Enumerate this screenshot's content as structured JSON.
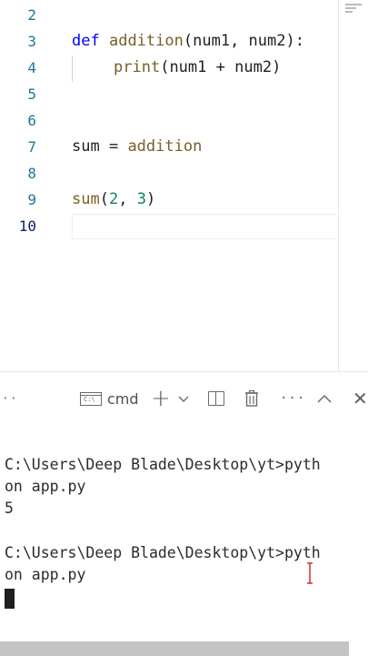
{
  "editor": {
    "line_numbers": [
      "2",
      "3",
      "4",
      "5",
      "6",
      "7",
      "8",
      "9",
      "10"
    ],
    "lines": {
      "def_keyword": "def",
      "def_name": "addition",
      "def_paren_open": "(",
      "def_param1": "num1",
      "def_comma": ", ",
      "def_param2": "num2",
      "def_paren_close": "):",
      "print_name": "print",
      "print_open": "(",
      "print_a": "num1",
      "print_op": " + ",
      "print_b": "num2",
      "print_close": ")",
      "assign_var": "sum",
      "assign_op": " = ",
      "assign_value": "addition",
      "call_name": "sum",
      "call_open": "(",
      "call_arg1": "2",
      "call_comma": ", ",
      "call_arg2": "3",
      "call_close": ")"
    }
  },
  "panel": {
    "more_left": "··",
    "terminal_tab_label": "cmd",
    "terminal_icon_text": "C:\\",
    "add_label": "+",
    "more_right": "···",
    "close_label": "✕"
  },
  "terminal": {
    "lines": [
      "C:\\Users\\Deep Blade\\Desktop\\yt>pyth",
      "on app.py",
      "5",
      "",
      "C:\\Users\\Deep Blade\\Desktop\\yt>pyth",
      "on app.py"
    ]
  },
  "icons": {
    "terminal": "terminal-icon",
    "add": "plus-icon",
    "dropdown": "chevron-down-icon",
    "split": "split-terminal-icon",
    "trash": "trash-icon",
    "maximize": "chevron-up-icon",
    "close": "close-icon",
    "cursor": "text-cursor-icon"
  }
}
